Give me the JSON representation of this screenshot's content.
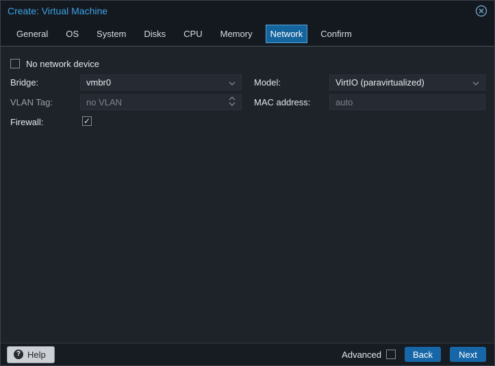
{
  "header": {
    "title": "Create: Virtual Machine"
  },
  "tabs": [
    "General",
    "OS",
    "System",
    "Disks",
    "CPU",
    "Memory",
    "Network",
    "Confirm"
  ],
  "active_tab": "Network",
  "form": {
    "no_network_device_label": "No network device",
    "bridge_label": "Bridge:",
    "bridge_value": "vmbr0",
    "vlan_label": "VLAN Tag:",
    "vlan_value": "no VLAN",
    "firewall_label": "Firewall:",
    "firewall_checked": "✓",
    "model_label": "Model:",
    "model_value": "VirtIO (paravirtualized)",
    "mac_label": "MAC address:",
    "mac_value": "auto"
  },
  "footer": {
    "help_label": "Help",
    "advanced_label": "Advanced",
    "back_label": "Back",
    "next_label": "Next"
  },
  "colors": {
    "title_blue": "#3da3e6",
    "active_tab_bg": "#14649e",
    "active_tab_border": "#58a8dc",
    "button_blue": "#1767a8"
  }
}
